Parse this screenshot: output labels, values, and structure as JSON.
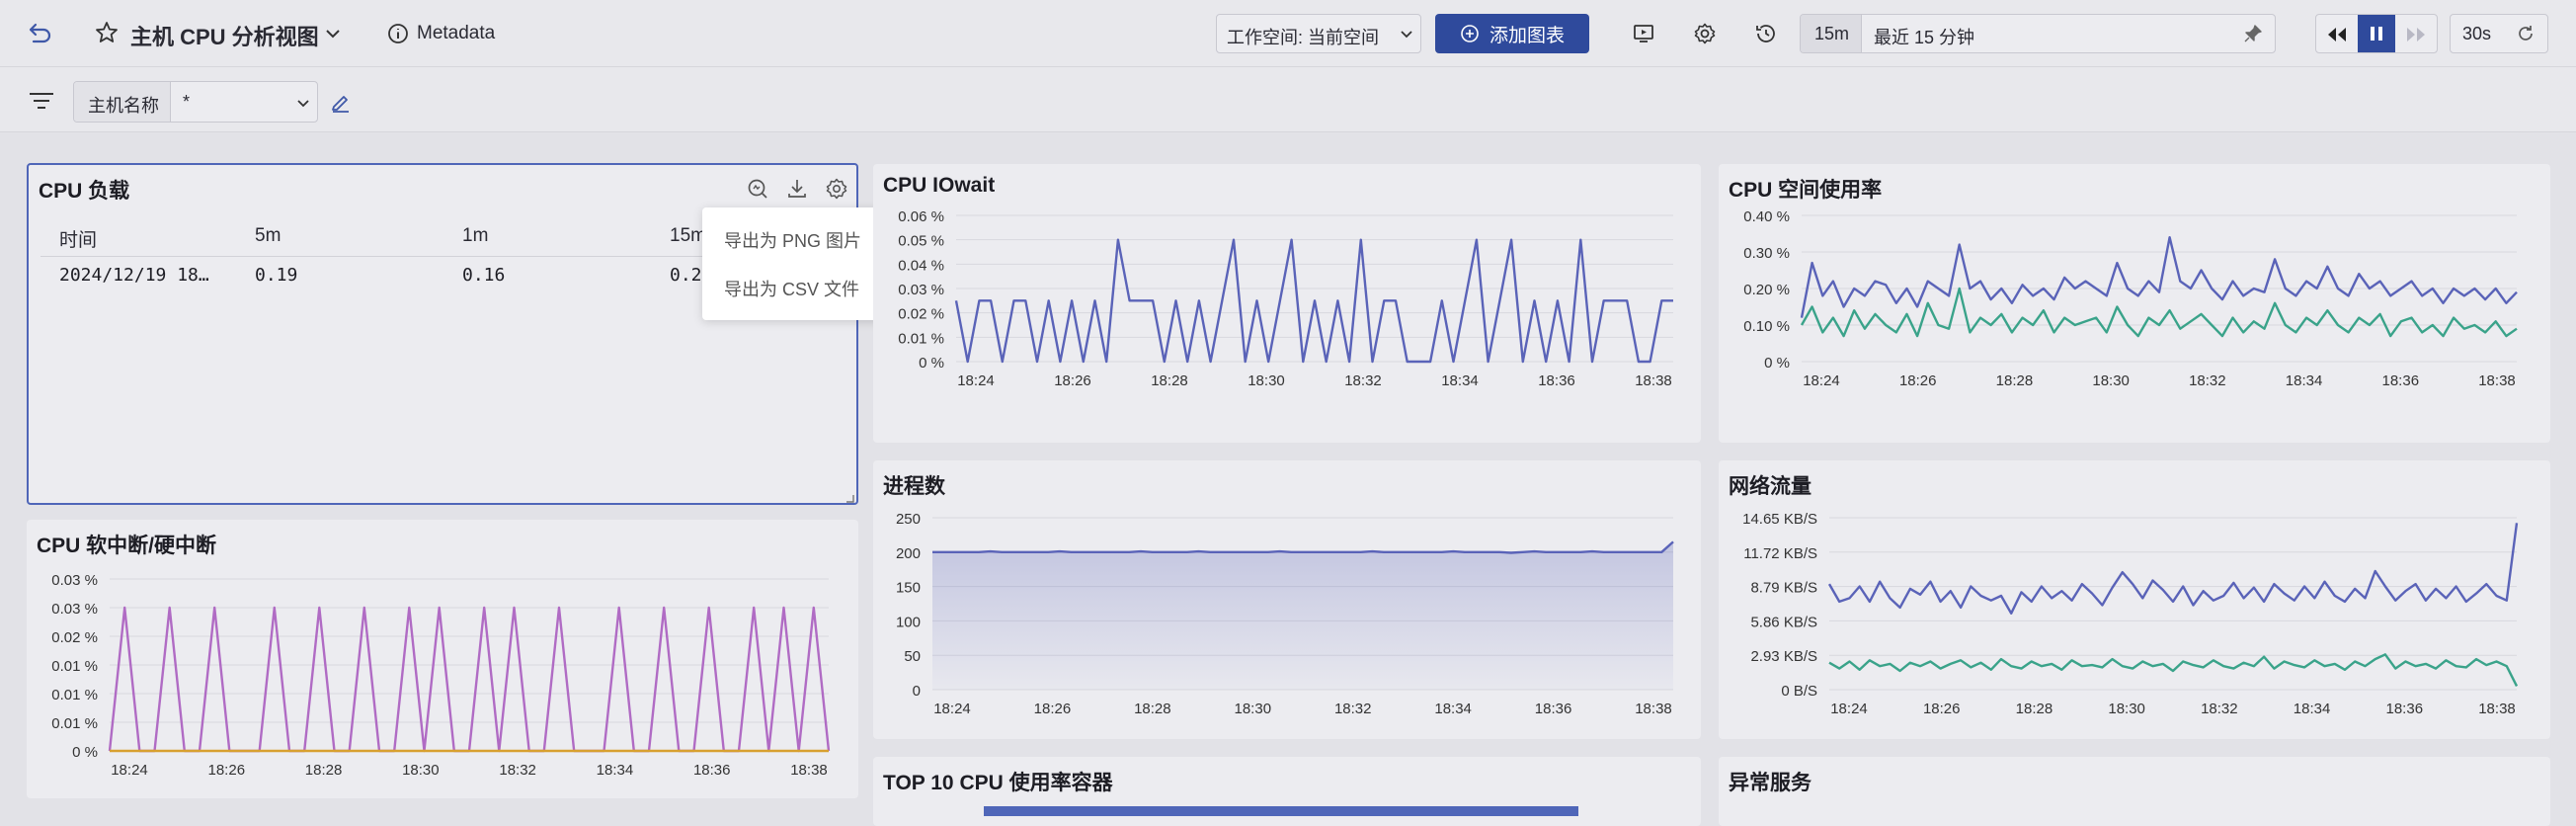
{
  "header": {
    "title": "主机 CPU 分析视图",
    "metadata_label": "Metadata",
    "workspace_label": "工作空间: 当前空间",
    "add_chart_label": "添加图表",
    "time_short": "15m",
    "time_range_label": "最近 15 分钟",
    "refresh_interval": "30s"
  },
  "filter": {
    "host_label": "主机名称",
    "host_value": "*"
  },
  "panels": {
    "cpu_load": {
      "title": "CPU 负载",
      "columns": [
        "时间",
        "5m",
        "1m",
        "15m"
      ],
      "row": [
        "2024/12/19 18…",
        "0.19",
        "0.16",
        "0.2"
      ],
      "menu": [
        "导出为 PNG 图片",
        "导出为 CSV 文件"
      ]
    },
    "cpu_iowait": {
      "title": "CPU IOwait"
    },
    "cpu_space": {
      "title": "CPU 空间使用率"
    },
    "cpu_irq": {
      "title": "CPU 软中断/硬中断"
    },
    "proc_count": {
      "title": "进程数"
    },
    "net_flow": {
      "title": "网络流量"
    },
    "top10": {
      "title": "TOP 10 CPU 使用率容器"
    },
    "abnormal": {
      "title": "异常服务"
    }
  },
  "colors": {
    "series_blue": "#5a63b8",
    "series_green": "#3aa38a",
    "series_purple": "#b06bc4",
    "series_orange": "#d8a030",
    "primary": "#2f4a9c"
  },
  "chart_data": [
    {
      "id": "iowait",
      "type": "line",
      "x": [
        "18:24",
        "18:26",
        "18:28",
        "18:30",
        "18:32",
        "18:34",
        "18:36",
        "18:38"
      ],
      "yticks": [
        "0.06 %",
        "0.05 %",
        "0.04 %",
        "0.03 %",
        "0.02 %",
        "0.01 %",
        "0 %"
      ],
      "ylim": [
        0,
        0.06
      ],
      "series": [
        {
          "values": [
            0.025,
            0,
            0.025,
            0.025,
            0,
            0.025,
            0.025,
            0,
            0.025,
            0,
            0.025,
            0,
            0.025,
            0,
            0.05,
            0.025,
            0.025,
            0.025,
            0,
            0.025,
            0,
            0.025,
            0,
            0.025,
            0.05,
            0,
            0.025,
            0,
            0.025,
            0.05,
            0,
            0.025,
            0,
            0.025,
            0,
            0.05,
            0,
            0.025,
            0.025,
            0,
            0,
            0,
            0.025,
            0,
            0.025,
            0.05,
            0,
            0.025,
            0.05,
            0,
            0.025,
            0,
            0.025,
            0,
            0.05,
            0,
            0.025,
            0.025,
            0.025,
            0,
            0,
            0.025,
            0.025
          ]
        }
      ]
    },
    {
      "id": "space",
      "type": "line",
      "x": [
        "18:24",
        "18:26",
        "18:28",
        "18:30",
        "18:32",
        "18:34",
        "18:36",
        "18:38"
      ],
      "yticks": [
        "0.40 %",
        "0.30 %",
        "0.20 %",
        "0.10 %",
        "0 %"
      ],
      "ylim": [
        0,
        0.4
      ],
      "series": [
        {
          "values": [
            0.12,
            0.27,
            0.18,
            0.22,
            0.15,
            0.2,
            0.18,
            0.22,
            0.21,
            0.16,
            0.2,
            0.15,
            0.22,
            0.2,
            0.18,
            0.32,
            0.2,
            0.22,
            0.17,
            0.2,
            0.16,
            0.21,
            0.18,
            0.2,
            0.17,
            0.23,
            0.2,
            0.22,
            0.2,
            0.18,
            0.27,
            0.2,
            0.18,
            0.22,
            0.19,
            0.34,
            0.22,
            0.2,
            0.25,
            0.2,
            0.17,
            0.22,
            0.18,
            0.2,
            0.19,
            0.28,
            0.2,
            0.18,
            0.22,
            0.2,
            0.26,
            0.2,
            0.18,
            0.24,
            0.2,
            0.22,
            0.18,
            0.2,
            0.22,
            0.18,
            0.2,
            0.16,
            0.2,
            0.18,
            0.2,
            0.17,
            0.2,
            0.16,
            0.19
          ]
        },
        {
          "values": [
            0.1,
            0.15,
            0.08,
            0.12,
            0.07,
            0.14,
            0.09,
            0.13,
            0.1,
            0.08,
            0.13,
            0.07,
            0.16,
            0.1,
            0.09,
            0.2,
            0.08,
            0.12,
            0.1,
            0.13,
            0.08,
            0.12,
            0.1,
            0.14,
            0.08,
            0.12,
            0.1,
            0.11,
            0.12,
            0.08,
            0.15,
            0.1,
            0.07,
            0.12,
            0.1,
            0.14,
            0.09,
            0.11,
            0.13,
            0.1,
            0.07,
            0.12,
            0.08,
            0.11,
            0.09,
            0.16,
            0.1,
            0.08,
            0.12,
            0.1,
            0.14,
            0.1,
            0.08,
            0.12,
            0.1,
            0.13,
            0.07,
            0.11,
            0.12,
            0.08,
            0.1,
            0.07,
            0.12,
            0.09,
            0.1,
            0.08,
            0.11,
            0.07,
            0.09
          ]
        }
      ]
    },
    {
      "id": "irq",
      "type": "line",
      "x": [
        "18:24",
        "18:26",
        "18:28",
        "18:30",
        "18:32",
        "18:34",
        "18:36",
        "18:38"
      ],
      "yticks": [
        "0.03 %",
        "0.03 %",
        "0.02 %",
        "0.01 %",
        "0.01 %",
        "0.01 %",
        "0 %"
      ],
      "ylim": [
        0,
        0.03
      ],
      "series": [
        {
          "values": [
            0,
            0.025,
            0,
            0,
            0.025,
            0,
            0,
            0.025,
            0,
            0,
            0,
            0.025,
            0,
            0,
            0.025,
            0,
            0,
            0.025,
            0,
            0,
            0.025,
            0,
            0.025,
            0,
            0,
            0.025,
            0,
            0.025,
            0,
            0,
            0.025,
            0,
            0,
            0,
            0.025,
            0,
            0,
            0.025,
            0,
            0,
            0.025,
            0,
            0,
            0.025,
            0,
            0.025,
            0,
            0.025,
            0
          ]
        },
        {
          "values": [
            0,
            0,
            0,
            0,
            0,
            0,
            0,
            0,
            0,
            0,
            0,
            0,
            0,
            0,
            0,
            0,
            0,
            0,
            0,
            0,
            0,
            0,
            0,
            0,
            0,
            0,
            0,
            0,
            0,
            0,
            0,
            0,
            0,
            0,
            0,
            0,
            0,
            0,
            0,
            0,
            0,
            0,
            0,
            0,
            0,
            0,
            0,
            0,
            0
          ]
        }
      ]
    },
    {
      "id": "proc",
      "type": "area",
      "x": [
        "18:24",
        "18:26",
        "18:28",
        "18:30",
        "18:32",
        "18:34",
        "18:36",
        "18:38"
      ],
      "yticks": [
        "250",
        "200",
        "150",
        "100",
        "50",
        "0"
      ],
      "ylim": [
        0,
        250
      ],
      "series": [
        {
          "values": [
            200,
            200,
            200,
            200,
            200,
            201,
            200,
            200,
            200,
            200,
            200,
            201,
            200,
            200,
            200,
            200,
            200,
            200,
            201,
            200,
            200,
            200,
            200,
            201,
            200,
            200,
            200,
            200,
            200,
            200,
            201,
            200,
            200,
            200,
            200,
            200,
            200,
            200,
            201,
            200,
            200,
            200,
            200,
            200,
            200,
            201,
            200,
            200,
            200,
            200,
            199,
            200,
            201,
            200,
            200,
            200,
            200,
            201,
            200,
            200,
            200,
            200,
            200,
            200,
            215
          ]
        }
      ]
    },
    {
      "id": "net",
      "type": "line",
      "x": [
        "18:24",
        "18:26",
        "18:28",
        "18:30",
        "18:32",
        "18:34",
        "18:36",
        "18:38"
      ],
      "yticks": [
        "14.65 KB/S",
        "11.72 KB/S",
        "8.79 KB/S",
        "5.86 KB/S",
        "2.93 KB/S",
        "0 B/S"
      ],
      "ylim": [
        0,
        14.65
      ],
      "series": [
        {
          "values": [
            9,
            7.5,
            7.8,
            8.8,
            7.5,
            9.2,
            7.8,
            7,
            8.6,
            8.1,
            9.2,
            7.5,
            8.4,
            7,
            8.8,
            8,
            7.6,
            8,
            6.5,
            8.3,
            7.5,
            8.8,
            7.8,
            8.4,
            7.6,
            9,
            8.2,
            7.2,
            8.7,
            10,
            9,
            7.8,
            9.3,
            8.5,
            7.5,
            8.8,
            7.2,
            8.4,
            7.6,
            8,
            9.1,
            7.8,
            8.7,
            7.5,
            9,
            8.2,
            7.6,
            8.8,
            7.8,
            9.2,
            8,
            7.5,
            8.6,
            7.8,
            10.1,
            8.8,
            7.6,
            8.4,
            9,
            7.6,
            8.6,
            7.8,
            8.8,
            7.5,
            8.2,
            9,
            8,
            7.6,
            14.2
          ]
        },
        {
          "values": [
            2.3,
            1.8,
            2.4,
            1.7,
            2.5,
            2,
            2.2,
            1.6,
            2.3,
            2,
            2.4,
            1.8,
            2.2,
            2.5,
            1.9,
            2.3,
            1.7,
            2.6,
            2,
            1.8,
            2.4,
            2,
            2.2,
            1.7,
            2.5,
            2,
            2.1,
            1.9,
            2.6,
            2,
            1.8,
            2.4,
            2,
            2.2,
            1.6,
            2.4,
            2.1,
            1.9,
            2.5,
            2,
            1.8,
            2.3,
            2,
            2.8,
            1.8,
            2.4,
            2.1,
            1.9,
            2.5,
            2,
            2.2,
            1.7,
            2.4,
            2,
            2.6,
            3,
            1.8,
            2.4,
            2,
            2.2,
            1.8,
            2.5,
            2,
            1.9,
            2.6,
            2.1,
            2.4,
            2,
            0.3
          ]
        }
      ]
    }
  ]
}
